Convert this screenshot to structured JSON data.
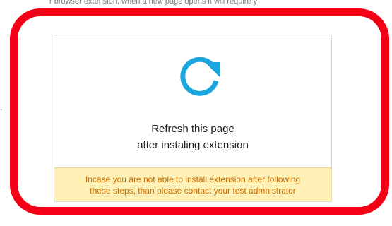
{
  "page": {
    "top_fragment": "r browser extension, when a new page opens it will require y",
    "side_mark": "."
  },
  "instruction_card": {
    "icon": "refresh-icon",
    "message_line_1": "Refresh this page",
    "message_line_2": "after instaling extension",
    "warning_line_1": "Incase you are not able to install extension after following",
    "warning_line_2": "these steps, than please contact your test admnistrator"
  },
  "colors": {
    "highlight": "#f30016",
    "icon": "#1aa6df",
    "warning_background": "#fff0b5",
    "warning_text": "#c96d00"
  }
}
